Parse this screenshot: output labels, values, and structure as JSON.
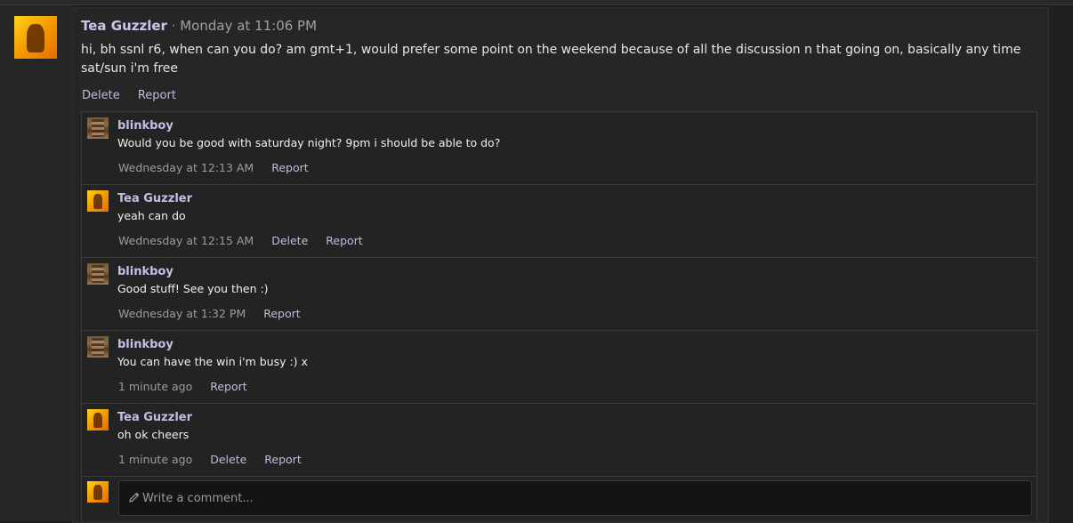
{
  "post": {
    "author": "Tea Guzzler",
    "separator": " · ",
    "time": "Monday at 11:06 PM",
    "body": "hi, bh ssnl r6, when can you do? am gmt+1, would prefer some point on the weekend because of all the discussion n that going on, basically any time sat/sun i'm free",
    "actions": {
      "delete": "Delete",
      "report": "Report"
    }
  },
  "comments": [
    {
      "author": "blinkboy",
      "text": "Would you be good with saturday night? 9pm i should be able to do?",
      "time": "Wednesday at 12:13 AM",
      "report": "Report"
    },
    {
      "author": "Tea Guzzler",
      "text": "yeah can do",
      "time": "Wednesday at 12:15 AM",
      "delete": "Delete",
      "report": "Report"
    },
    {
      "author": "blinkboy",
      "text": "Good stuff! See you then :)",
      "time": "Wednesday at 1:32 PM",
      "report": "Report"
    },
    {
      "author": "blinkboy",
      "text": "You can have the win i'm busy :) x",
      "time": "1 minute ago",
      "report": "Report"
    },
    {
      "author": "Tea Guzzler",
      "text": "oh ok cheers",
      "time": "1 minute ago",
      "delete": "Delete",
      "report": "Report"
    }
  ],
  "reply": {
    "placeholder": "Write a comment..."
  },
  "icons": {
    "post_avatar": "avatar-icon",
    "reply": "pencil-icon"
  },
  "colors": {
    "background": "#1c1c1c",
    "author": "#c8c8ee",
    "link": "#bdbdd8"
  }
}
